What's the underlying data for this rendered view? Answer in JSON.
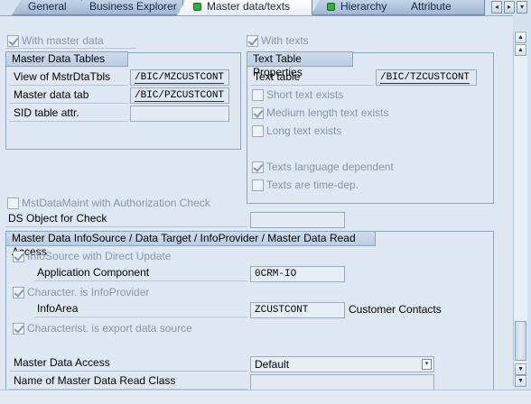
{
  "tabs": [
    {
      "label": "General",
      "icon": ""
    },
    {
      "label": "Business Explorer",
      "icon": ""
    },
    {
      "label": "Master data/texts",
      "icon": "green-status-icon",
      "active": true
    },
    {
      "label": "Hierarchy",
      "icon": "green-status-icon"
    },
    {
      "label": "Attribute",
      "icon": ""
    }
  ],
  "tab_nav": {
    "scroll_left": "◂",
    "scroll_right": "▸",
    "menu": "▾"
  },
  "top_options": {
    "with_master_data": "With master data",
    "with_texts": "With texts"
  },
  "master_data_tables": {
    "title": "Master Data Tables",
    "view_label": "View of MstrDtaTbls",
    "view_value": "/BIC/MZCUSTCONT",
    "tab_label": "Master data tab",
    "tab_value": "/BIC/PZCUSTCONT",
    "sid_label": "SID table attr.",
    "sid_value": ""
  },
  "text_table_properties": {
    "title": "Text Table Properties",
    "text_table_label": "Text table",
    "text_table_value": "/BIC/TZCUSTCONT",
    "short_text": "Short text exists",
    "medium_text": "Medium length text exists",
    "long_text": "Long text exists",
    "language_dependent": "Texts language dependent",
    "time_dependent": "Texts are time-dep."
  },
  "auth_check": {
    "label": "MstDataMaint with Authorization Check",
    "ds_object_label": "DS Object for Check",
    "ds_object_value": ""
  },
  "infosource_group": {
    "title": "Master Data InfoSource / Data Target / InfoProvider / Master Data Read Access",
    "direct_update": "InfoSource with Direct Update",
    "app_component_label": "Application Component",
    "app_component_value": "0CRM-IO",
    "is_infoprovider": "Character. is InfoProvider",
    "infoarea_label": "InfoArea",
    "infoarea_value": "ZCUSTCONT",
    "infoarea_desc": "Customer Contacts",
    "export_source": "Characterist. is export data source",
    "access_label": "Master Data Access",
    "access_value": "Default",
    "read_class_label": "Name of Master Data Read Class",
    "read_class_value": ""
  },
  "scrollbar": {
    "up": "▲",
    "down": "▼",
    "thumb_position": 0.87
  }
}
